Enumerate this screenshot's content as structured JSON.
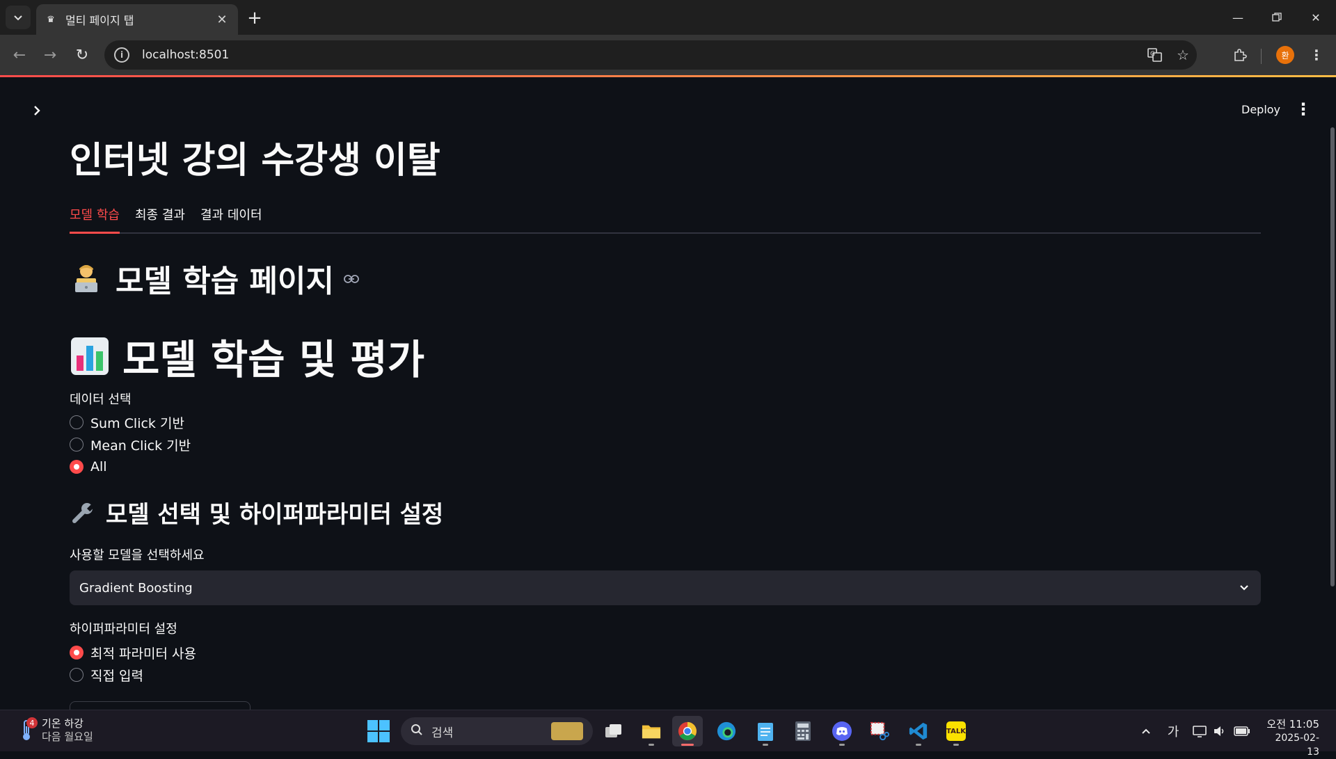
{
  "browser": {
    "tab_title": "멀티 페이지 탭",
    "url": "localhost:8501",
    "profile_initial": "환"
  },
  "app": {
    "deploy_label": "Deploy",
    "title": "인터넷 강의 수강생 이탈",
    "tabs": [
      {
        "label": "모델 학습",
        "active": true
      },
      {
        "label": "최종 결과",
        "active": false
      },
      {
        "label": "결과 데이터",
        "active": false
      }
    ],
    "page_heading": "모델 학습 페이지",
    "page_heading_emoji": "🧑‍💻",
    "section_heading": "모델 학습 및 평가",
    "section_heading_emoji": "📊",
    "data_select": {
      "label": "데이터 선택",
      "options": [
        {
          "label": "Sum Click 기반",
          "selected": false
        },
        {
          "label": "Mean Click 기반",
          "selected": false
        },
        {
          "label": "All",
          "selected": true
        }
      ]
    },
    "model_heading": "모델 선택 및 하이퍼파라미터 설정",
    "model_heading_emoji": "🔧",
    "model_select": {
      "label": "사용할 모델을 선택하세요",
      "value": "Gradient Boosting"
    },
    "hyperparam": {
      "label": "하이퍼파라미터 설정",
      "options": [
        {
          "label": "최적 파라미터 사용",
          "selected": true
        },
        {
          "label": "직접 입력",
          "selected": false
        }
      ]
    },
    "accent_color": "#ff4b4b"
  },
  "taskbar": {
    "weather_badge": "4",
    "weather_line1": "기온 하강",
    "weather_line2": "다음 월요일",
    "search_placeholder": "검색",
    "ime": "가",
    "time": "오전 11:05",
    "date": "2025-02-13"
  }
}
